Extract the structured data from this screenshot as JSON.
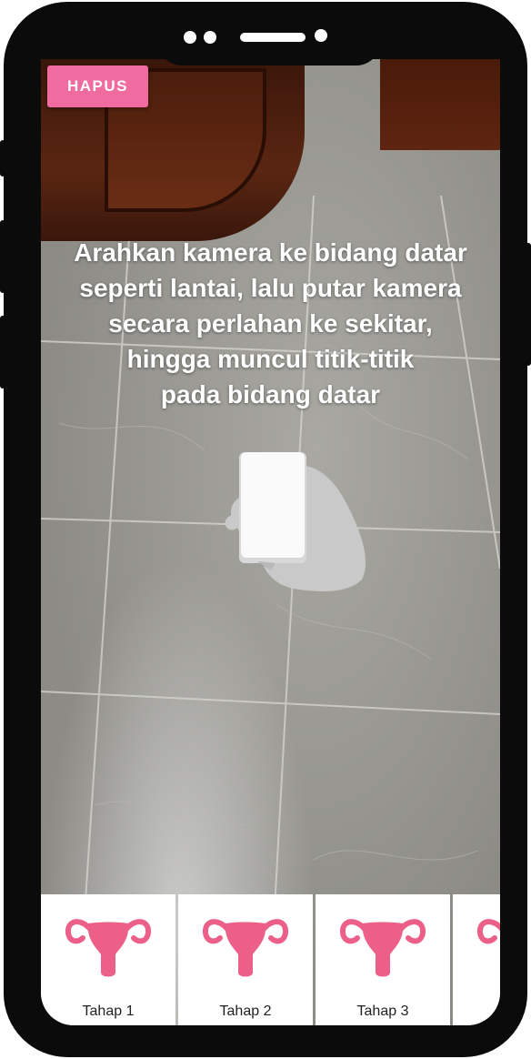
{
  "toolbar": {
    "clear_label": "HAPUS"
  },
  "instruction": {
    "lines": [
      "Arahkan kamera ke bidang datar",
      "seperti lantai, lalu putar kamera",
      "secara perlahan ke sekitar,",
      "hingga muncul titik-titik",
      "pada bidang datar"
    ]
  },
  "stages": [
    {
      "label": "Tahap 1",
      "icon": "uterus-icon"
    },
    {
      "label": "Tahap 2",
      "icon": "uterus-icon"
    },
    {
      "label": "Tahap 3",
      "icon": "uterus-icon"
    },
    {
      "label": "",
      "icon": "uterus-icon"
    }
  ],
  "colors": {
    "accent": "#f06ba0",
    "icon": "#ec5f88"
  }
}
